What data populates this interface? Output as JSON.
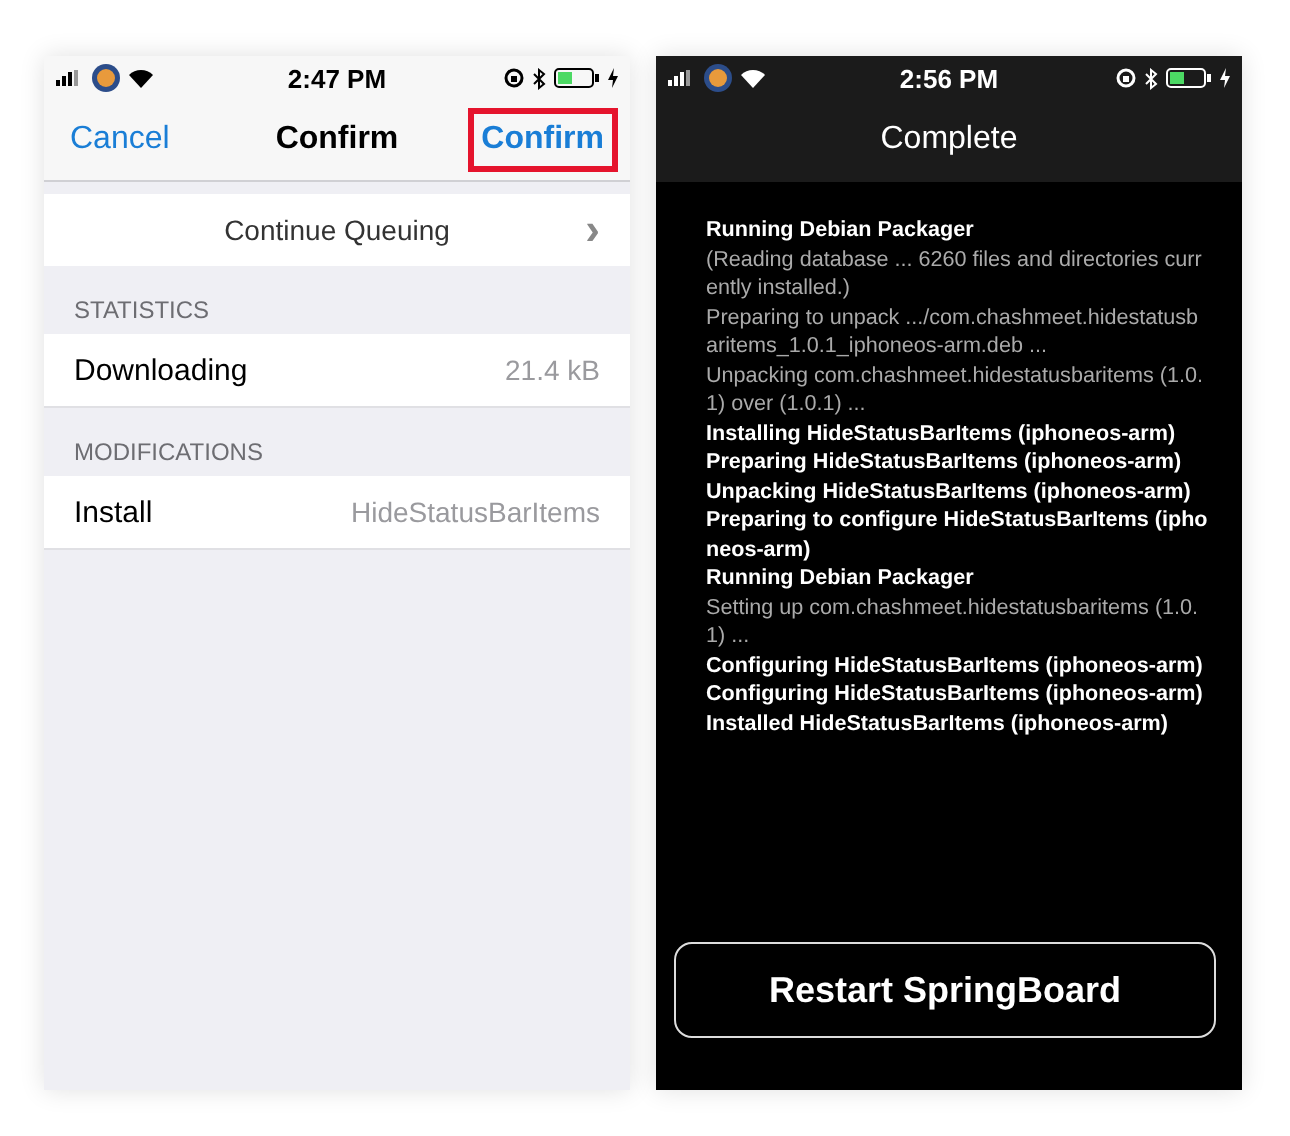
{
  "screens": [
    {
      "kind": "light",
      "status_bar": {
        "time": "2:47 PM"
      },
      "nav": {
        "left": "Cancel",
        "title": "Confirm",
        "right": {
          "label": "Confirm",
          "highlighted": true
        }
      },
      "continue_row": {
        "label": "Continue Queuing",
        "chevron": "›"
      },
      "sections": [
        {
          "header": "STATISTICS",
          "rows": [
            {
              "label": "Downloading",
              "value": "21.4 kB"
            }
          ]
        },
        {
          "header": "MODIFICATIONS",
          "rows": [
            {
              "label": "Install",
              "value": "HideStatusBarItems"
            }
          ]
        }
      ]
    },
    {
      "kind": "dark",
      "status_bar": {
        "time": "2:56 PM"
      },
      "nav": {
        "title": "Complete"
      },
      "log": [
        {
          "kind": "bold",
          "text": "Running Debian Packager"
        },
        {
          "kind": "plain",
          "text": "(Reading database ... 6260 files and directories currently installed.)"
        },
        {
          "kind": "plain",
          "text": "Preparing to unpack .../com.chashmeet.hidestatusbaritems_1.0.1_iphoneos-arm.deb ..."
        },
        {
          "kind": "plain",
          "text": "Unpacking com.chashmeet.hidestatusbaritems (1.0.1) over (1.0.1) ..."
        },
        {
          "kind": "bold",
          "text": "Installing HideStatusBarItems (iphoneos-arm)"
        },
        {
          "kind": "bold",
          "text": "Preparing HideStatusBarItems (iphoneos-arm)"
        },
        {
          "kind": "bold",
          "text": "Unpacking HideStatusBarItems (iphoneos-arm)"
        },
        {
          "kind": "bold",
          "text": "Preparing to configure HideStatusBarItems (iphoneos-arm)"
        },
        {
          "kind": "bold",
          "text": "Running Debian Packager"
        },
        {
          "kind": "plain",
          "text": "Setting up com.chashmeet.hidestatusbaritems (1.0.1) ..."
        },
        {
          "kind": "bold",
          "text": "Configuring HideStatusBarItems (iphoneos-arm)"
        },
        {
          "kind": "bold",
          "text": "Configuring HideStatusBarItems (iphoneos-arm)"
        },
        {
          "kind": "bold",
          "text": "Installed HideStatusBarItems (iphoneos-arm)"
        }
      ],
      "button": "Restart SpringBoard"
    }
  ]
}
